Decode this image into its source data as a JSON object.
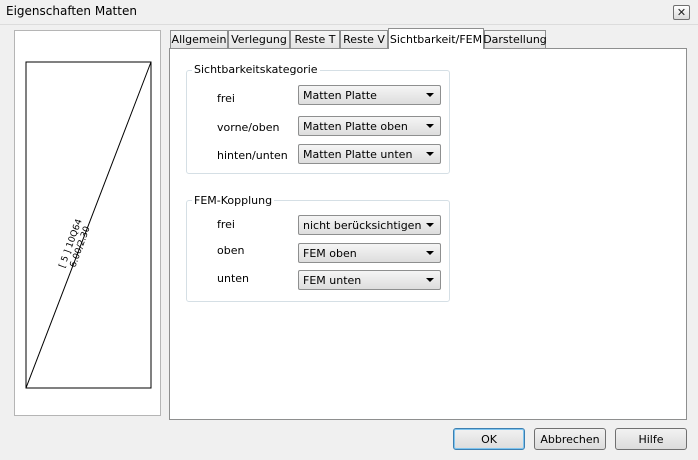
{
  "window": {
    "title": "Eigenschaften Matten",
    "close_symbol": "✕"
  },
  "preview": {
    "label_line1": "[ 5 ] 10Q64",
    "label_line2": "6.00/2.30"
  },
  "tabs": [
    {
      "label": "Allgemein",
      "active": false
    },
    {
      "label": "Verlegung",
      "active": false
    },
    {
      "label": "Reste T",
      "active": false
    },
    {
      "label": "Reste V",
      "active": false
    },
    {
      "label": "Sichtbarkeit/FEM",
      "active": true
    },
    {
      "label": "Darstellung",
      "active": false
    }
  ],
  "sichtbarkeit": {
    "title": "Sichtbarkeitskategorie",
    "rows": [
      {
        "label": "frei",
        "value": "Matten Platte"
      },
      {
        "label": "vorne/oben",
        "value": "Matten Platte oben"
      },
      {
        "label": "hinten/unten",
        "value": "Matten Platte unten"
      }
    ]
  },
  "fem": {
    "title": "FEM-Kopplung",
    "rows": [
      {
        "label": "frei",
        "value": "nicht berücksichtigen"
      },
      {
        "label": "oben",
        "value": "FEM oben"
      },
      {
        "label": "unten",
        "value": "FEM unten"
      }
    ]
  },
  "buttons": {
    "ok": "OK",
    "cancel": "Abbrechen",
    "help": "Hilfe"
  }
}
